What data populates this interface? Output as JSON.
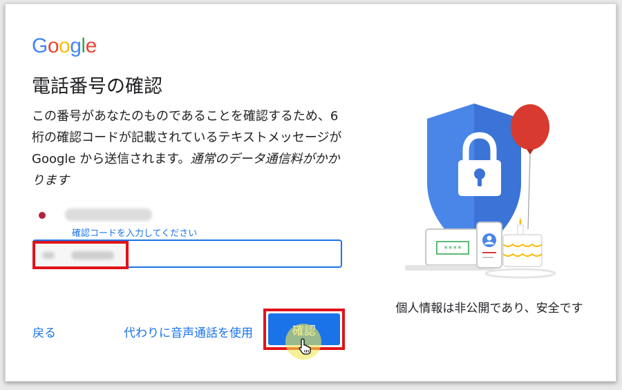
{
  "logo": {
    "letters": [
      "G",
      "o",
      "o",
      "g",
      "l",
      "e"
    ],
    "colors": [
      "#4285F4",
      "#EA4335",
      "#FBBC05",
      "#4285F4",
      "#34A853",
      "#EA4335"
    ]
  },
  "title": "電話番号の確認",
  "description": {
    "text": "この番号があなたのものであることを確認するため、6 桁の確認コードが記載されているテキストメッセージが Google から送信されます。",
    "italic": "通常のデータ通信料がかかります"
  },
  "code_field": {
    "label": "確認コードを入力してください",
    "value": ""
  },
  "actions": {
    "back": "戻る",
    "voice_call": "代わりに音声通話を使用",
    "confirm": "確認"
  },
  "illustration": {
    "screen_text": "****",
    "icons": [
      "shield-icon",
      "lock-icon",
      "balloon-icon",
      "laptop-icon",
      "phone-icon",
      "cake-icon"
    ]
  },
  "privacy_note": "個人情報は非公開であり、安全です",
  "colors": {
    "accent": "#1a73e8",
    "highlight_border": "#e0131a",
    "shield": "#4a86e8",
    "balloon": "#d93a2f",
    "phone_dot": "#b0243b"
  }
}
